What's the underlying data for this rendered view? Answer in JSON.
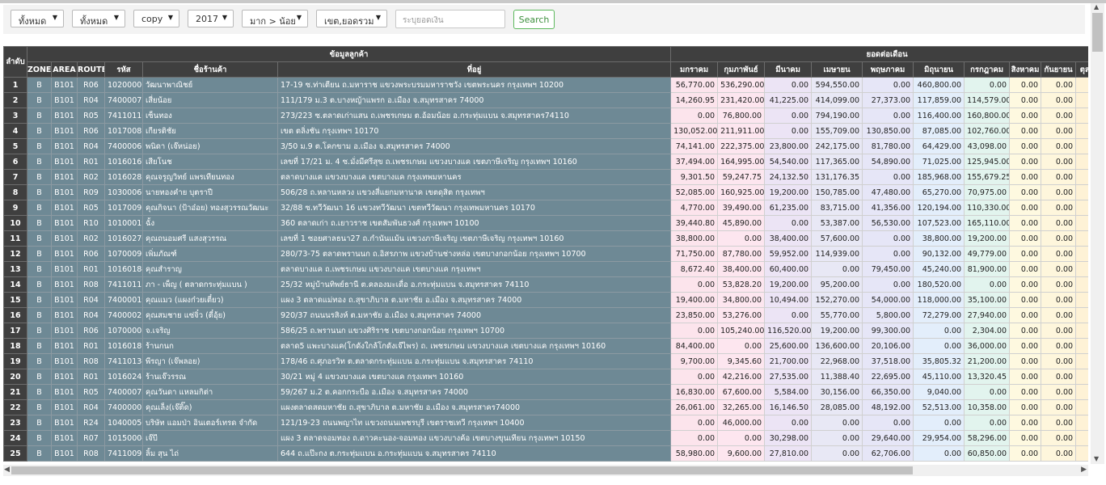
{
  "filters": {
    "f1": "ทั้งหมด",
    "f2": "ทั้งหมด",
    "f3": "copy",
    "year": "2017",
    "sort": "มาก > น้อย",
    "total": "เขต,ยอดรวม",
    "amount_placeholder": "ระบุยอดเงิน",
    "search_label": "Search",
    "caret": "▼"
  },
  "headers": {
    "seq": "ลำดับ",
    "customer_info": "ข้อมูลลูกค้า",
    "monthly_total": "ยอดต่อเดือน",
    "zone": "ZONE",
    "area": "AREA",
    "route": "ROUTE",
    "code": "รหัส",
    "shop": "ชื่อร้านค้า",
    "address": "ที่อยู่",
    "months": [
      "มกราคม",
      "กุมภาพันธ์",
      "มีนาคม",
      "เมษายน",
      "พฤษภาคม",
      "มิถุนายน",
      "กรกฎาคม",
      "สิงหาคม",
      "กันยายน",
      "ตุลาค"
    ]
  },
  "month_colors": [
    "#fce4ec",
    "#fde6ef",
    "#ece4f5",
    "#e8e8f5",
    "#e6e6f7",
    "#e3eefb",
    "#e2f4ee",
    "#fef9e0",
    "#fef6dc",
    "#fef2d6"
  ],
  "rows": [
    {
      "n": "1",
      "zone": "B",
      "area": "B101",
      "route": "R06",
      "code": "10200006",
      "shop": "วัฒนาพาณิชย์",
      "addr": "17-19 ซ.ท่าเตียน ถ.มหาราช แขวงพระบรมมหาราชวัง เขตพระนคร กรุงเทพฯ 10200",
      "m": [
        "56,770.00",
        "536,290.00",
        "0.00",
        "594,550.00",
        "0.00",
        "460,800.00",
        "0.00",
        "0.00",
        "0.00",
        "0.0"
      ]
    },
    {
      "n": "2",
      "zone": "B",
      "area": "B101",
      "route": "R04",
      "code": "74000075",
      "shop": "เสี่ยน้อย",
      "addr": "111/179 ม.3 ต.บางหญ้าแพรก อ.เมือง จ.สมุทรสาคร 74000",
      "m": [
        "14,260.95",
        "231,420.00",
        "41,225.00",
        "414,099.00",
        "27,373.00",
        "117,859.00",
        "114,579.00",
        "0.00",
        "0.00",
        "0.0"
      ]
    },
    {
      "n": "3",
      "zone": "B",
      "area": "B101",
      "route": "R05",
      "code": "74110110",
      "shop": "เซ็นทอง",
      "addr": "273/223 ซ.ตลาดเก่าแสน ถ.เพชรเกษม ต.อ้อมน้อย อ.กระทุ่มแบน จ.สมุทรสาคร74110",
      "m": [
        "0.00",
        "76,800.00",
        "0.00",
        "794,190.00",
        "0.00",
        "116,400.00",
        "160,800.00",
        "0.00",
        "0.00",
        "0.0"
      ]
    },
    {
      "n": "4",
      "zone": "B",
      "area": "B101",
      "route": "R06",
      "code": "10170082",
      "shop": "เกียรติชัย",
      "addr": "เขต ตลิ่งชัน กรุงเทพฯ 10170",
      "m": [
        "130,052.00",
        "211,911.00",
        "0.00",
        "155,709.00",
        "130,850.00",
        "87,085.00",
        "102,760.00",
        "0.00",
        "0.00",
        "0.0"
      ]
    },
    {
      "n": "5",
      "zone": "B",
      "area": "B101",
      "route": "R04",
      "code": "74000069",
      "shop": "พนิดา (เจ๊หน่อย)",
      "addr": "3/50 ม.9 ต.โคกขาม อ.เมือง จ.สมุทรสาคร 74000",
      "m": [
        "74,141.00",
        "222,375.00",
        "23,800.00",
        "242,175.00",
        "81,780.00",
        "64,429.00",
        "43,098.00",
        "0.00",
        "0.00",
        "0.0"
      ]
    },
    {
      "n": "6",
      "zone": "B",
      "area": "B101",
      "route": "R01",
      "code": "10160169",
      "shop": "เสียโนช",
      "addr": "เลขที่ 17/21 ม. 4 ซ.มั่งมีศรีสุข ถ.เพชรเกษม แขวงบางแค เขตภาษีเจริญ กรุงเทพฯ 10160",
      "m": [
        "37,494.00",
        "164,995.00",
        "54,540.00",
        "117,365.00",
        "54,890.00",
        "71,025.00",
        "125,945.00",
        "0.00",
        "0.00",
        "0.0"
      ]
    },
    {
      "n": "7",
      "zone": "B",
      "area": "B101",
      "route": "R02",
      "code": "10160282",
      "shop": "คุณจรูญวิทย์ แพรเทียนทอง",
      "addr": "ตลาดบางแค แขวงบางแค เขตบางแค กรุงเทพมหานคร",
      "m": [
        "9,301.50",
        "59,247.75",
        "24,132.50",
        "131,176.35",
        "0.00",
        "185,968.00",
        "155,679.25",
        "0.00",
        "0.00",
        "0.0"
      ]
    },
    {
      "n": "8",
      "zone": "B",
      "area": "B101",
      "route": "R09",
      "code": "10300060",
      "shop": "นายทองคำย บุตราปี",
      "addr": "506/28 ถ.หลานหลวง แขวงสี่แยกมหานาค เขตดุสิต กรุงเทพฯ",
      "m": [
        "52,085.00",
        "160,925.00",
        "19,200.00",
        "150,785.00",
        "47,480.00",
        "65,270.00",
        "70,975.00",
        "0.00",
        "0.00",
        "0.0"
      ]
    },
    {
      "n": "9",
      "zone": "B",
      "area": "B101",
      "route": "R05",
      "code": "10170097",
      "shop": "คุณกิจนา (ป้าอ๋อย) ทองสุวรรณวัฒนะ",
      "addr": "32/88 ซ.ทวีวัฒนา 16 แขวงทวีวัฒนา เขตทวีวัฒนา กรุงเทพมหานคร 10170",
      "m": [
        "4,770.00",
        "39,490.00",
        "61,235.00",
        "83,715.00",
        "41,356.00",
        "120,194.00",
        "110,330.00",
        "0.00",
        "0.00",
        "0.0"
      ]
    },
    {
      "n": "10",
      "zone": "B",
      "area": "B101",
      "route": "R10",
      "code": "10100019",
      "shop": "ฉั้ง",
      "addr": "360 ตลาดเก่า ถ.เยาวราช เขตสัมพันธวงศ์ กรุงเทพฯ 10100",
      "m": [
        "39,440.80",
        "45,890.00",
        "0.00",
        "53,387.00",
        "56,530.00",
        "107,523.00",
        "165,110.00",
        "0.00",
        "0.00",
        "0.0"
      ]
    },
    {
      "n": "11",
      "zone": "B",
      "area": "B101",
      "route": "R02",
      "code": "10160270",
      "shop": "คุณถนอมศรี แสงสุวรรณ",
      "addr": "เลขที่ 1 ซอยศาลธนา27 ถ.กำนันแม้น แขวงภาษีเจริญ เขตภาษีเจริญ กรุงเทพฯ 10160",
      "m": [
        "38,800.00",
        "0.00",
        "38,400.00",
        "57,600.00",
        "0.00",
        "38,800.00",
        "19,200.00",
        "0.00",
        "0.00",
        "0.0"
      ]
    },
    {
      "n": "12",
      "zone": "B",
      "area": "B101",
      "route": "R06",
      "code": "10700096",
      "shop": "เพิ่มภัณฑ์",
      "addr": "280/73-75 ตลาดพรานนก ถ.อิสรภาพ แขวงบ้านช่างหล่อ เขตบางกอกน้อย กรุงเทพฯ 10700",
      "m": [
        "71,750.00",
        "87,780.00",
        "59,952.00",
        "114,939.00",
        "0.00",
        "90,132.00",
        "49,779.00",
        "0.00",
        "0.00",
        "0.0"
      ]
    },
    {
      "n": "13",
      "zone": "B",
      "area": "B101",
      "route": "R01",
      "code": "10160184",
      "shop": "คุณสำราญ",
      "addr": "ตลาดบางแค ถ.เพชรเกษม แขวงบางแค เขตบางแค กรุงเทพฯ",
      "m": [
        "8,672.40",
        "38,400.00",
        "60,400.00",
        "0.00",
        "79,450.00",
        "45,240.00",
        "81,900.00",
        "0.00",
        "0.00",
        "0.0"
      ]
    },
    {
      "n": "14",
      "zone": "B",
      "area": "B101",
      "route": "R08",
      "code": "74110118",
      "shop": "ภา - เพ็ญ ( ตลาดกระทุ่มแบน )",
      "addr": "25/32 หมู่บ้านทิพย์ธานี ต.คลองมะเดื่อ อ.กระทุ่มแบน จ.สมุทรสาคร 74110",
      "m": [
        "0.00",
        "53,828.20",
        "19,200.00",
        "95,200.00",
        "0.00",
        "180,520.00",
        "0.00",
        "0.00",
        "0.00",
        "0.0"
      ]
    },
    {
      "n": "15",
      "zone": "B",
      "area": "B101",
      "route": "R04",
      "code": "74000019",
      "shop": "คุณแมว (แผงก๋วยเตี๋ยว)",
      "addr": "แผง 3 ตลาดแม่ทอง ถ.สุขาภิบาล ต.มหาชัย อ.เมือง จ.สมุทรสาคร 74000",
      "m": [
        "19,400.00",
        "34,800.00",
        "10,494.00",
        "152,270.00",
        "54,000.00",
        "118,000.00",
        "35,100.00",
        "0.00",
        "0.00",
        "0.0"
      ]
    },
    {
      "n": "16",
      "zone": "B",
      "area": "B101",
      "route": "R04",
      "code": "74000021",
      "shop": "คุณสมชาย แซ่จิ๋ว (ตี๋อุ้ย)",
      "addr": "920/37 ถนนนรสิงห์ ต.มหาชัย อ.เมือง จ.สมุทรสาคร 74000",
      "m": [
        "23,850.00",
        "53,276.00",
        "0.00",
        "55,770.00",
        "5,800.00",
        "72,279.00",
        "27,940.00",
        "0.00",
        "0.00",
        "0.0"
      ]
    },
    {
      "n": "17",
      "zone": "B",
      "area": "B101",
      "route": "R06",
      "code": "10700005",
      "shop": "จ.เจริญ",
      "addr": "586/25 ถ.พรานนก แขวงศิริราช เขตบางกอกน้อย กรุงเทพฯ 10700",
      "m": [
        "0.00",
        "105,240.00",
        "116,520.00",
        "19,200.00",
        "99,300.00",
        "0.00",
        "2,304.00",
        "0.00",
        "0.00",
        "0.0"
      ]
    },
    {
      "n": "18",
      "zone": "B",
      "area": "B101",
      "route": "R01",
      "code": "10160189",
      "shop": "ร้านกนก",
      "addr": "ตลาด5 แพะบางแค(โกดังใกล้โกดังเจ๊ไพร) ถ. เพชรเกษม แขวงบางแค เขตบางแค กรุงเทพฯ 10160",
      "m": [
        "84,400.00",
        "0.00",
        "25,600.00",
        "136,600.00",
        "20,106.00",
        "0.00",
        "36,000.00",
        "0.00",
        "0.00",
        "0.0"
      ]
    },
    {
      "n": "19",
      "zone": "B",
      "area": "B101",
      "route": "R08",
      "code": "74110134",
      "shop": "พีรญา (เจ๊พลอย)",
      "addr": "178/46 ถ.ศุภอรวิท ต.ตลาดกระทุ่มแบน อ.กระทุ่มแบน จ.สมุทรสาคร 74110",
      "m": [
        "9,700.00",
        "9,345.60",
        "21,700.00",
        "22,968.00",
        "37,518.00",
        "35,805.32",
        "21,200.00",
        "0.00",
        "0.00",
        "0.0"
      ]
    },
    {
      "n": "20",
      "zone": "B",
      "area": "B101",
      "route": "R01",
      "code": "10160247",
      "shop": "ร้านเจ๊วรรณ",
      "addr": "30/21 หมู่ 4 แขวงบางแค เขตบางแค กรุงเทพฯ 10160",
      "m": [
        "0.00",
        "42,216.00",
        "27,535.00",
        "11,388.40",
        "22,695.00",
        "45,110.00",
        "13,320.45",
        "0.00",
        "0.00",
        "0.0"
      ]
    },
    {
      "n": "21",
      "zone": "B",
      "area": "B101",
      "route": "R05",
      "code": "74000078",
      "shop": "คุณวันดา แหลมกิต่า",
      "addr": "59/267 ม.2 ต.คอกกระบือ อ.เมือง จ.สมุทรสาคร 74000",
      "m": [
        "16,830.00",
        "67,600.00",
        "5,584.00",
        "30,156.00",
        "66,350.00",
        "9,040.00",
        "0.00",
        "0.00",
        "0.00",
        "0.0"
      ]
    },
    {
      "n": "22",
      "zone": "B",
      "area": "B101",
      "route": "R04",
      "code": "74000002",
      "shop": "คุณเล็ง(เจ๊ติ๊ด)",
      "addr": "แผงตลาดสดมหาชัย ถ.สุขาภิบาล ต.มหาชัย อ.เมือง จ.สมุทรสาคร74000",
      "m": [
        "26,061.00",
        "32,265.00",
        "16,146.50",
        "28,085.00",
        "48,192.00",
        "52,513.00",
        "10,358.00",
        "0.00",
        "0.00",
        "0.0"
      ]
    },
    {
      "n": "23",
      "zone": "B",
      "area": "B101",
      "route": "R24",
      "code": "10400050",
      "shop": "บริษัท แอมป่า อินเตอร์เทรด จำกัด",
      "addr": "121/19-23 ถนนพญาไท แขวงถนนเพชรบุรี เขตราชเทวี กรุงเทพฯ 10400",
      "m": [
        "0.00",
        "46,000.00",
        "0.00",
        "0.00",
        "0.00",
        "0.00",
        "0.00",
        "0.00",
        "0.00",
        "0.0"
      ]
    },
    {
      "n": "24",
      "zone": "B",
      "area": "B101",
      "route": "R07",
      "code": "10150004",
      "shop": "เจ๊บี",
      "addr": "แผง 3 ตลาดจอมทอง ถ.ดาวคะนอง-จอมทอง แขวงบางค้อ เขตบางขุนเทียน กรุงเทพฯ 10150",
      "m": [
        "0.00",
        "0.00",
        "30,298.00",
        "0.00",
        "29,640.00",
        "29,954.00",
        "58,296.00",
        "0.00",
        "0.00",
        "0.0"
      ]
    },
    {
      "n": "25",
      "zone": "B",
      "area": "B101",
      "route": "R08",
      "code": "74110092",
      "shop": "ลิ้ม สุน ไถ่",
      "addr": "644 ถ.แป๊ะกง ต.กระทุ่มแบน อ.กระทุ่มแบน จ.สมุทรสาคร 74110",
      "m": [
        "58,980.00",
        "9,600.00",
        "27,810.00",
        "0.00",
        "62,706.00",
        "0.00",
        "60,850.00",
        "0.00",
        "0.00",
        "0.0"
      ]
    }
  ]
}
